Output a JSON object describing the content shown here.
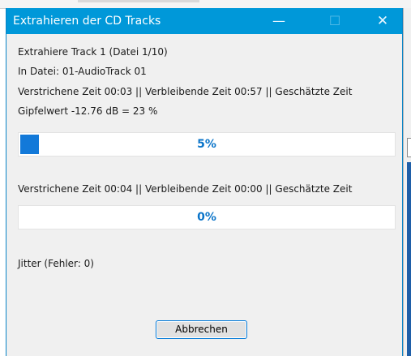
{
  "dialog": {
    "title": "Extrahieren der CD Tracks",
    "titlebar": {
      "minimize_glyph": "—",
      "maximize_glyph": "☐",
      "close_glyph": "✕"
    },
    "status": {
      "extracting": "Extrahiere Track 1  (Datei 1/10)",
      "file": "In Datei: 01-AudioTrack 01",
      "track_times": "Verstrichene Zeit 00:03 || Verbleibende Zeit 00:57 || Geschätzte Zeit",
      "peak": "Gipfelwert -12.76 dB =  23 %"
    },
    "track_progress": {
      "label": "5%",
      "value": 0.05
    },
    "total_times": "Verstrichene Zeit 00:04 || Verbleibende Zeit 00:00 || Geschätzte Zeit",
    "total_progress": {
      "label": "0%",
      "value": 0.0
    },
    "jitter": "Jitter (Fehler: 0)",
    "cancel_label": "Abbrechen"
  },
  "colors": {
    "titlebar": "#0098d9",
    "progress_fill": "#1279d9",
    "percent_text": "#0a74c9"
  }
}
